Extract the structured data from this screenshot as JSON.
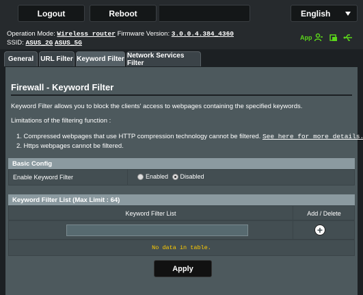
{
  "topbar": {
    "logout_label": "Logout",
    "reboot_label": "Reboot",
    "language": "English"
  },
  "info": {
    "operation_mode_label": "Operation Mode:",
    "operation_mode_value": "Wireless router",
    "firmware_label": "Firmware Version:",
    "firmware_value": "3.0.0.4.384_4360",
    "ssid_label": "SSID:",
    "ssid_2g": "ASUS_2G",
    "ssid_5g": "ASUS_5G",
    "app_label": "App",
    "accent_color": "#5bd61b"
  },
  "tabs": [
    {
      "label": "General"
    },
    {
      "label": "URL Filter"
    },
    {
      "label": "Keyword Filter"
    },
    {
      "label": "Network Services Filter"
    }
  ],
  "page": {
    "title": "Firewall - Keyword Filter",
    "description": "Keyword Filter allows you to block the clients' access to webpages containing the specified keywords.",
    "limitations_heading": "Limitations of the filtering function :",
    "limitation_1": "1. Compressed webpages that use HTTP compression technology cannot be filtered.",
    "limitation_1_link": "See here for more details.",
    "limitation_2": "2. Https webpages cannot be filtered."
  },
  "basic_config": {
    "header": "Basic Config",
    "enable_label": "Enable Keyword Filter",
    "option_enabled": "Enabled",
    "option_disabled": "Disabled",
    "selected": "Disabled"
  },
  "keyword_list": {
    "header": "Keyword Filter List (Max Limit : 64)",
    "col_keyword": "Keyword Filter List",
    "col_add_delete": "Add / Delete",
    "input_value": "",
    "empty_message": "No data in table."
  },
  "apply_label": "Apply"
}
